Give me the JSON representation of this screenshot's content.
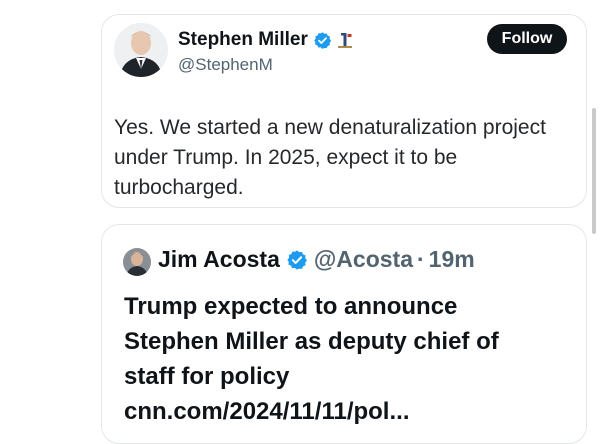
{
  "tweet": {
    "author_name": "Stephen Miller",
    "author_handle": "@StephenM",
    "follow_label": "Follow",
    "text_lines": [
      "Yes. We started a new denaturalization project",
      "under Trump. In 2025, expect it to be",
      "turbocharged."
    ]
  },
  "quoted_tweet": {
    "author_name": "Jim Acosta",
    "author_handle": "@Acosta",
    "separator": "·",
    "time": "19m",
    "text_lines": [
      "Trump expected to announce",
      "Stephen Miller as deputy chief of",
      "staff for policy",
      "cnn.com/2024/11/11/pol..."
    ]
  },
  "icons": {
    "verified": "verified-badge-icon",
    "affiliate": "flag-badge-icon"
  },
  "colors": {
    "verified_blue": "#1d9bf0",
    "follow_button_bg": "#0f1419",
    "secondary_text": "#536471"
  }
}
